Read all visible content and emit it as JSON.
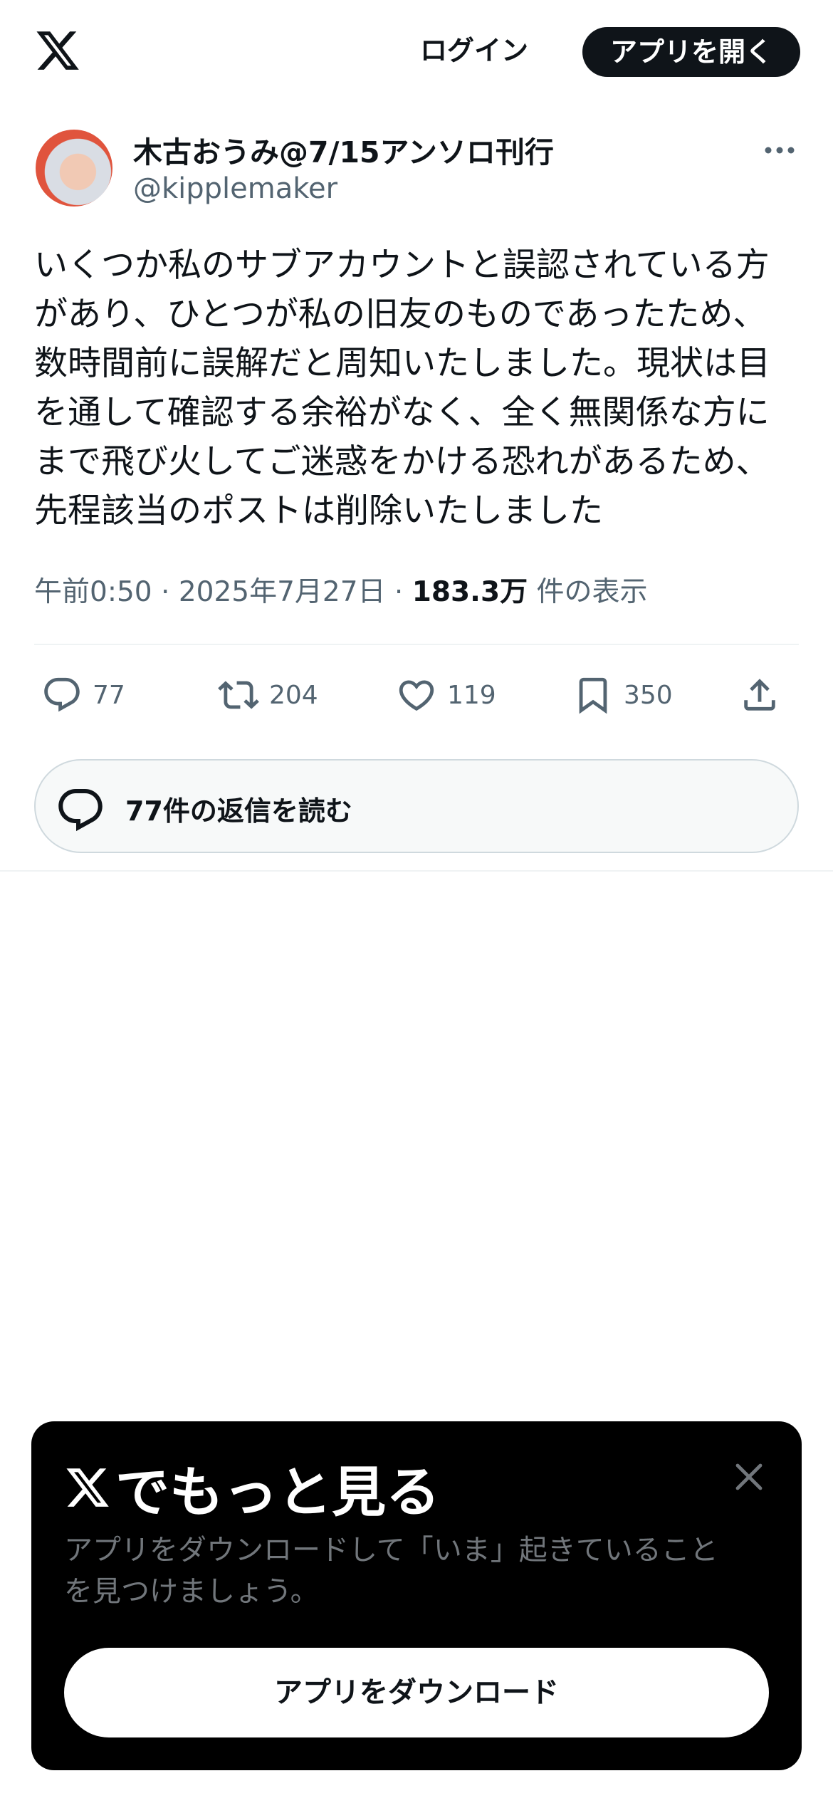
{
  "header": {
    "logo_icon": "x-logo-icon",
    "login_label": "ログイン",
    "open_app_label": "アプリを開く"
  },
  "author": {
    "display_name": "木古おうみ@7/15アンソロ刊行",
    "handle": "@kipplemaker"
  },
  "tweet": {
    "text": "いくつか私のサブアカウントと誤認されている方\nがあり、ひとつが私の旧友のものであったため、\n数時間前に誤解だと周知いたしました。現状は目\nを通して確認する余裕がなく、全く無関係な方に\nまで飛び火してご迷惑をかける恐れがあるため、\n先程該当のポストは削除いたしました",
    "time": "午前0:50",
    "date": "2025年7月27日",
    "separator": "·",
    "views_count": "183.3万",
    "views_label": "件の表示"
  },
  "actions": {
    "replies": "77",
    "reposts": "204",
    "likes": "119",
    "bookmarks": "350"
  },
  "read_replies_label": "77件の返信を読む",
  "promo": {
    "title": "でもっと見る",
    "description": "アプリをダウンロードして「いま」起きていること\nを見つけましょう。",
    "button_label": "アプリをダウンロード"
  },
  "colors": {
    "text_primary": "#0f1419",
    "text_secondary": "#536471",
    "promo_bg": "#000000",
    "promo_desc": "#71767b"
  }
}
